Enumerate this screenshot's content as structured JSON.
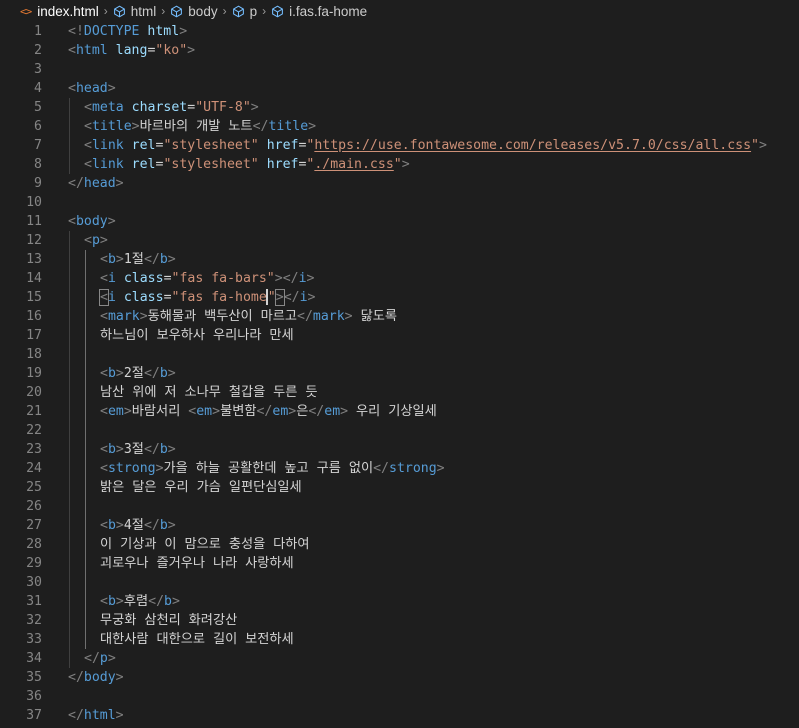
{
  "breadcrumb": {
    "file": "index.html",
    "items": [
      "html",
      "body",
      "p",
      "i.fas.fa-home"
    ]
  },
  "editor": {
    "lines": [
      {
        "n": "1",
        "indent": 0,
        "toks": [
          [
            "t",
            "<!"
          ],
          [
            "n",
            "DOCTYPE"
          ],
          [
            "x",
            " "
          ],
          [
            "a",
            "html"
          ],
          [
            "t",
            ">"
          ]
        ]
      },
      {
        "n": "2",
        "indent": 0,
        "toks": [
          [
            "t",
            "<"
          ],
          [
            "n",
            "html"
          ],
          [
            "x",
            " "
          ],
          [
            "a",
            "lang"
          ],
          [
            "x",
            "="
          ],
          [
            "s",
            "\"ko\""
          ],
          [
            "t",
            ">"
          ]
        ]
      },
      {
        "n": "3",
        "indent": 0,
        "toks": []
      },
      {
        "n": "4",
        "indent": 0,
        "toks": [
          [
            "t",
            "<"
          ],
          [
            "n",
            "head"
          ],
          [
            "t",
            ">"
          ]
        ]
      },
      {
        "n": "5",
        "indent": 1,
        "toks": [
          [
            "t",
            "<"
          ],
          [
            "n",
            "meta"
          ],
          [
            "x",
            " "
          ],
          [
            "a",
            "charset"
          ],
          [
            "x",
            "="
          ],
          [
            "s",
            "\"UTF-8\""
          ],
          [
            "t",
            ">"
          ]
        ]
      },
      {
        "n": "6",
        "indent": 1,
        "toks": [
          [
            "t",
            "<"
          ],
          [
            "n",
            "title"
          ],
          [
            "t",
            ">"
          ],
          [
            "x",
            "바르바의 개발 노트"
          ],
          [
            "t",
            "</"
          ],
          [
            "n",
            "title"
          ],
          [
            "t",
            ">"
          ]
        ]
      },
      {
        "n": "7",
        "indent": 1,
        "toks": [
          [
            "t",
            "<"
          ],
          [
            "n",
            "link"
          ],
          [
            "x",
            " "
          ],
          [
            "a",
            "rel"
          ],
          [
            "x",
            "="
          ],
          [
            "s",
            "\"stylesheet\""
          ],
          [
            "x",
            " "
          ],
          [
            "a",
            "href"
          ],
          [
            "x",
            "="
          ],
          [
            "s",
            "\""
          ],
          [
            "su",
            "https://use.fontawesome.com/releases/v5.7.0/css/all.css"
          ],
          [
            "s",
            "\""
          ],
          [
            "t",
            ">"
          ]
        ]
      },
      {
        "n": "8",
        "indent": 1,
        "toks": [
          [
            "t",
            "<"
          ],
          [
            "n",
            "link"
          ],
          [
            "x",
            " "
          ],
          [
            "a",
            "rel"
          ],
          [
            "x",
            "="
          ],
          [
            "s",
            "\"stylesheet\""
          ],
          [
            "x",
            " "
          ],
          [
            "a",
            "href"
          ],
          [
            "x",
            "="
          ],
          [
            "s",
            "\""
          ],
          [
            "su",
            "./main.css"
          ],
          [
            "s",
            "\""
          ],
          [
            "t",
            ">"
          ]
        ]
      },
      {
        "n": "9",
        "indent": 0,
        "toks": [
          [
            "t",
            "</"
          ],
          [
            "n",
            "head"
          ],
          [
            "t",
            ">"
          ]
        ]
      },
      {
        "n": "10",
        "indent": 0,
        "toks": []
      },
      {
        "n": "11",
        "indent": 0,
        "toks": [
          [
            "t",
            "<"
          ],
          [
            "n",
            "body"
          ],
          [
            "t",
            ">"
          ]
        ]
      },
      {
        "n": "12",
        "indent": 1,
        "toks": [
          [
            "t",
            "<"
          ],
          [
            "n",
            "p"
          ],
          [
            "t",
            ">"
          ]
        ]
      },
      {
        "n": "13",
        "indent": 2,
        "toks": [
          [
            "t",
            "<"
          ],
          [
            "n",
            "b"
          ],
          [
            "t",
            ">"
          ],
          [
            "x",
            "1절"
          ],
          [
            "t",
            "</"
          ],
          [
            "n",
            "b"
          ],
          [
            "t",
            ">"
          ]
        ]
      },
      {
        "n": "14",
        "indent": 2,
        "toks": [
          [
            "t",
            "<"
          ],
          [
            "n",
            "i"
          ],
          [
            "x",
            " "
          ],
          [
            "a",
            "class"
          ],
          [
            "x",
            "="
          ],
          [
            "s",
            "\"fas fa-bars\""
          ],
          [
            "t",
            ">"
          ],
          [
            "t",
            "</"
          ],
          [
            "n",
            "i"
          ],
          [
            "t",
            ">"
          ]
        ]
      },
      {
        "n": "15",
        "indent": 2,
        "toks": [
          [
            "th",
            "<"
          ],
          [
            "n",
            "i"
          ],
          [
            "x",
            " "
          ],
          [
            "a",
            "class"
          ],
          [
            "x",
            "="
          ],
          [
            "s",
            "\"fas fa-home"
          ],
          [
            "cur",
            ""
          ],
          [
            "s",
            "\""
          ],
          [
            "th",
            ">"
          ],
          [
            "t",
            "</"
          ],
          [
            "n",
            "i"
          ],
          [
            "t",
            ">"
          ]
        ]
      },
      {
        "n": "16",
        "indent": 2,
        "toks": [
          [
            "t",
            "<"
          ],
          [
            "n",
            "mark"
          ],
          [
            "t",
            ">"
          ],
          [
            "x",
            "동해물과 백두산이 마르고"
          ],
          [
            "t",
            "</"
          ],
          [
            "n",
            "mark"
          ],
          [
            "t",
            ">"
          ],
          [
            "x",
            " 닳도록"
          ]
        ]
      },
      {
        "n": "17",
        "indent": 2,
        "toks": [
          [
            "x",
            "하느님이 보우하사 우리나라 만세"
          ]
        ]
      },
      {
        "n": "18",
        "indent": 0,
        "toks": []
      },
      {
        "n": "19",
        "indent": 2,
        "toks": [
          [
            "t",
            "<"
          ],
          [
            "n",
            "b"
          ],
          [
            "t",
            ">"
          ],
          [
            "x",
            "2절"
          ],
          [
            "t",
            "</"
          ],
          [
            "n",
            "b"
          ],
          [
            "t",
            ">"
          ]
        ]
      },
      {
        "n": "20",
        "indent": 2,
        "toks": [
          [
            "x",
            "남산 위에 저 소나무 철갑을 두른 듯"
          ]
        ]
      },
      {
        "n": "21",
        "indent": 2,
        "toks": [
          [
            "t",
            "<"
          ],
          [
            "n",
            "em"
          ],
          [
            "t",
            ">"
          ],
          [
            "x",
            "바람서리 "
          ],
          [
            "t",
            "<"
          ],
          [
            "n",
            "em"
          ],
          [
            "t",
            ">"
          ],
          [
            "x",
            "불변함"
          ],
          [
            "t",
            "</"
          ],
          [
            "n",
            "em"
          ],
          [
            "t",
            ">"
          ],
          [
            "x",
            "은"
          ],
          [
            "t",
            "</"
          ],
          [
            "n",
            "em"
          ],
          [
            "t",
            ">"
          ],
          [
            "x",
            " 우리 기상일세"
          ]
        ]
      },
      {
        "n": "22",
        "indent": 0,
        "toks": []
      },
      {
        "n": "23",
        "indent": 2,
        "toks": [
          [
            "t",
            "<"
          ],
          [
            "n",
            "b"
          ],
          [
            "t",
            ">"
          ],
          [
            "x",
            "3절"
          ],
          [
            "t",
            "</"
          ],
          [
            "n",
            "b"
          ],
          [
            "t",
            ">"
          ]
        ]
      },
      {
        "n": "24",
        "indent": 2,
        "toks": [
          [
            "t",
            "<"
          ],
          [
            "n",
            "strong"
          ],
          [
            "t",
            ">"
          ],
          [
            "x",
            "가을 하늘 공활한데 높고 구름 없이"
          ],
          [
            "t",
            "</"
          ],
          [
            "n",
            "strong"
          ],
          [
            "t",
            ">"
          ]
        ]
      },
      {
        "n": "25",
        "indent": 2,
        "toks": [
          [
            "x",
            "밝은 달은 우리 가슴 일편단심일세"
          ]
        ]
      },
      {
        "n": "26",
        "indent": 0,
        "toks": []
      },
      {
        "n": "27",
        "indent": 2,
        "toks": [
          [
            "t",
            "<"
          ],
          [
            "n",
            "b"
          ],
          [
            "t",
            ">"
          ],
          [
            "x",
            "4절"
          ],
          [
            "t",
            "</"
          ],
          [
            "n",
            "b"
          ],
          [
            "t",
            ">"
          ]
        ]
      },
      {
        "n": "28",
        "indent": 2,
        "toks": [
          [
            "x",
            "이 기상과 이 맘으로 충성을 다하여"
          ]
        ]
      },
      {
        "n": "29",
        "indent": 2,
        "toks": [
          [
            "x",
            "괴로우나 즐거우나 나라 사랑하세"
          ]
        ]
      },
      {
        "n": "30",
        "indent": 0,
        "toks": []
      },
      {
        "n": "31",
        "indent": 2,
        "toks": [
          [
            "t",
            "<"
          ],
          [
            "n",
            "b"
          ],
          [
            "t",
            ">"
          ],
          [
            "x",
            "후렴"
          ],
          [
            "t",
            "</"
          ],
          [
            "n",
            "b"
          ],
          [
            "t",
            ">"
          ]
        ]
      },
      {
        "n": "32",
        "indent": 2,
        "toks": [
          [
            "x",
            "무궁화 삼천리 화려강산"
          ]
        ]
      },
      {
        "n": "33",
        "indent": 2,
        "toks": [
          [
            "x",
            "대한사람 대한으로 길이 보전하세"
          ]
        ]
      },
      {
        "n": "34",
        "indent": 1,
        "toks": [
          [
            "t",
            "</"
          ],
          [
            "n",
            "p"
          ],
          [
            "t",
            ">"
          ]
        ]
      },
      {
        "n": "35",
        "indent": 0,
        "toks": [
          [
            "t",
            "</"
          ],
          [
            "n",
            "body"
          ],
          [
            "t",
            ">"
          ]
        ]
      },
      {
        "n": "36",
        "indent": 0,
        "toks": []
      },
      {
        "n": "37",
        "indent": 0,
        "toks": [
          [
            "t",
            "</"
          ],
          [
            "n",
            "html"
          ],
          [
            "t",
            ">"
          ]
        ]
      }
    ]
  },
  "colors": {
    "tag_bracket": "#808080",
    "tag_name": "#569cd6",
    "attr": "#9cdcfe",
    "string": "#ce9178",
    "text": "#d4d4d4",
    "line_number": "#858585",
    "background": "#1e1e1e"
  }
}
